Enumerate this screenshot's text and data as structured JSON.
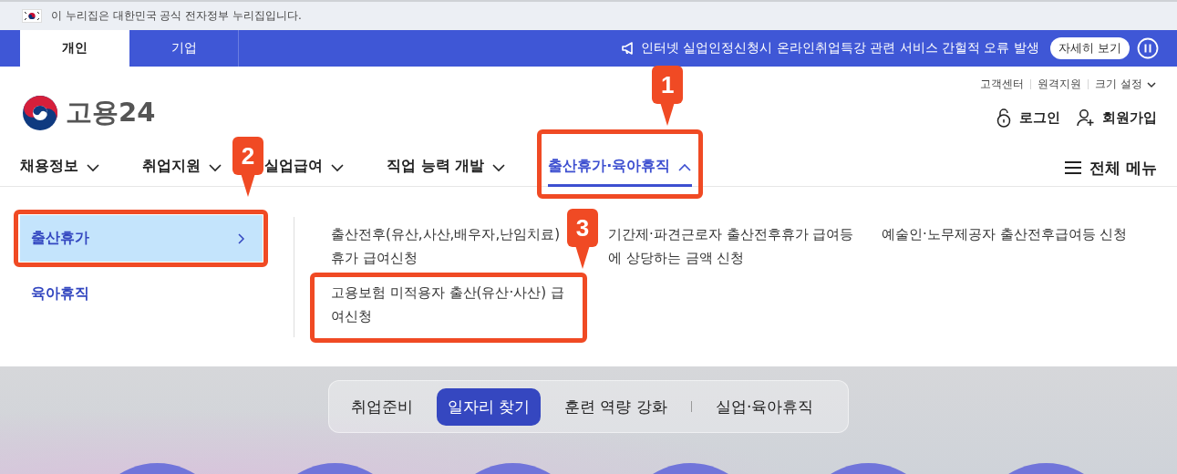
{
  "gov_banner": {
    "text": "이 누리집은 대한민국 공식 전자정부 누리집입니다."
  },
  "audience_tabs": [
    {
      "label": "개인",
      "selected": true
    },
    {
      "label": "기업",
      "selected": false
    }
  ],
  "notice": {
    "text": "인터넷 실업인정신청시 온라인취업특강 관련 서비스 간헐적 오류 발생",
    "button": "자세히 보기"
  },
  "utility_links": [
    {
      "label": "고객센터",
      "kind": "link"
    },
    {
      "label": "원격지원",
      "kind": "link"
    },
    {
      "label": "크기 설정",
      "kind": "dropdown"
    }
  ],
  "logo": {
    "text": "고용24"
  },
  "account_links": [
    {
      "label": "로그인",
      "kind": "login"
    },
    {
      "label": "회원가입",
      "kind": "signup"
    }
  ],
  "main_nav": [
    {
      "label": "채용정보",
      "expanded": false,
      "selected": false
    },
    {
      "label": "취업지원",
      "expanded": false,
      "selected": false
    },
    {
      "label": "실업급여",
      "expanded": false,
      "selected": false
    },
    {
      "label": "직업 능력 개발",
      "expanded": false,
      "selected": false
    },
    {
      "label": "출산휴가·육아휴직",
      "expanded": true,
      "selected": true,
      "callout": "1"
    }
  ],
  "all_menu": {
    "label": "전체 메뉴"
  },
  "submenu": [
    {
      "label": "출산휴가",
      "selected": true,
      "callout": "2"
    },
    {
      "label": "육아휴직",
      "selected": false
    }
  ],
  "submenu_link_rows": [
    {
      "links": [
        {
          "label": "출산전후(유산,사산,배우자,난임치료)휴가 급여신청"
        },
        {
          "label": "기간제·파견근로자 출산전후휴가 급여등에 상당하는 금액 신청"
        },
        {
          "label": "예술인·노무제공자 출산전후급여등 신청"
        }
      ]
    },
    {
      "links": [
        {
          "label": "고용보험 미적용자 출산(유산·사산) 급여신청",
          "callout": "3"
        }
      ]
    }
  ],
  "category_tabs": [
    {
      "label": "취업준비",
      "selected": false
    },
    {
      "label": "일자리 찾기",
      "selected": true
    },
    {
      "label": "훈련 역량 강화",
      "selected": false
    },
    {
      "label": "실업·육아휴직",
      "selected": false
    }
  ]
}
